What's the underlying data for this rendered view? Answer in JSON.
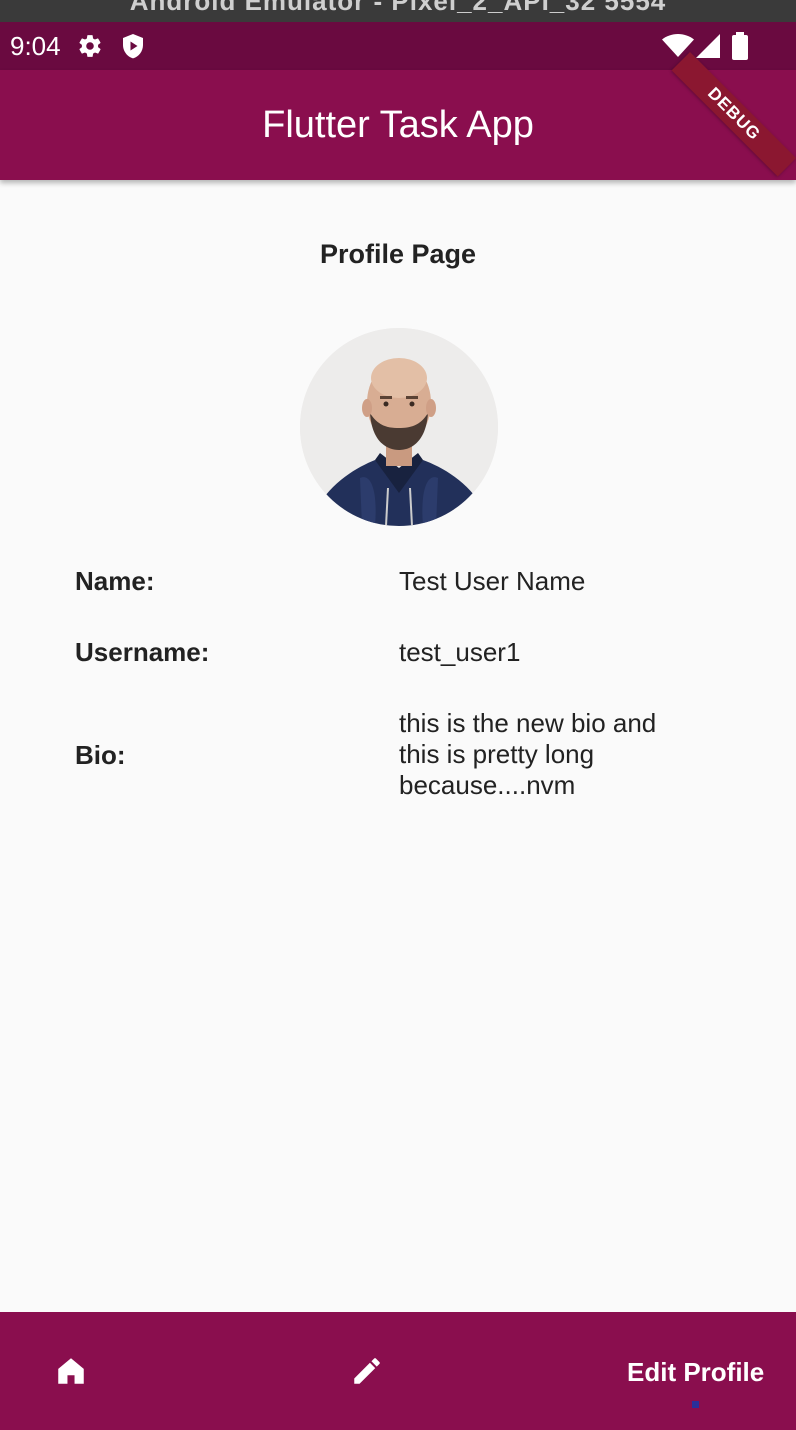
{
  "emulator": {
    "title": "Android Emulator - Pixel_2_API_32 5554"
  },
  "status_bar": {
    "time": "9:04",
    "icons": [
      "gear-icon",
      "shield-icon",
      "wifi-icon",
      "signal-icon",
      "battery-icon"
    ]
  },
  "app_bar": {
    "title": "Flutter Task App"
  },
  "debug_banner": {
    "label": "DEBUG"
  },
  "profile": {
    "heading": "Profile Page",
    "fields": [
      {
        "label": "Name:",
        "value": "Test User Name"
      },
      {
        "label": "Username:",
        "value": "test_user1"
      },
      {
        "label": "Bio:",
        "value": "this is the new bio and this is pretty long because....nvm"
      }
    ]
  },
  "bottom_nav": {
    "items": [
      {
        "icon": "home-icon"
      },
      {
        "icon": "pencil-icon"
      },
      {
        "label": "Edit Profile"
      }
    ]
  },
  "colors": {
    "primary": "#8a0e4e",
    "status_bar": "#6a0a40",
    "background": "#fafafa",
    "debug": "#8b1730"
  }
}
